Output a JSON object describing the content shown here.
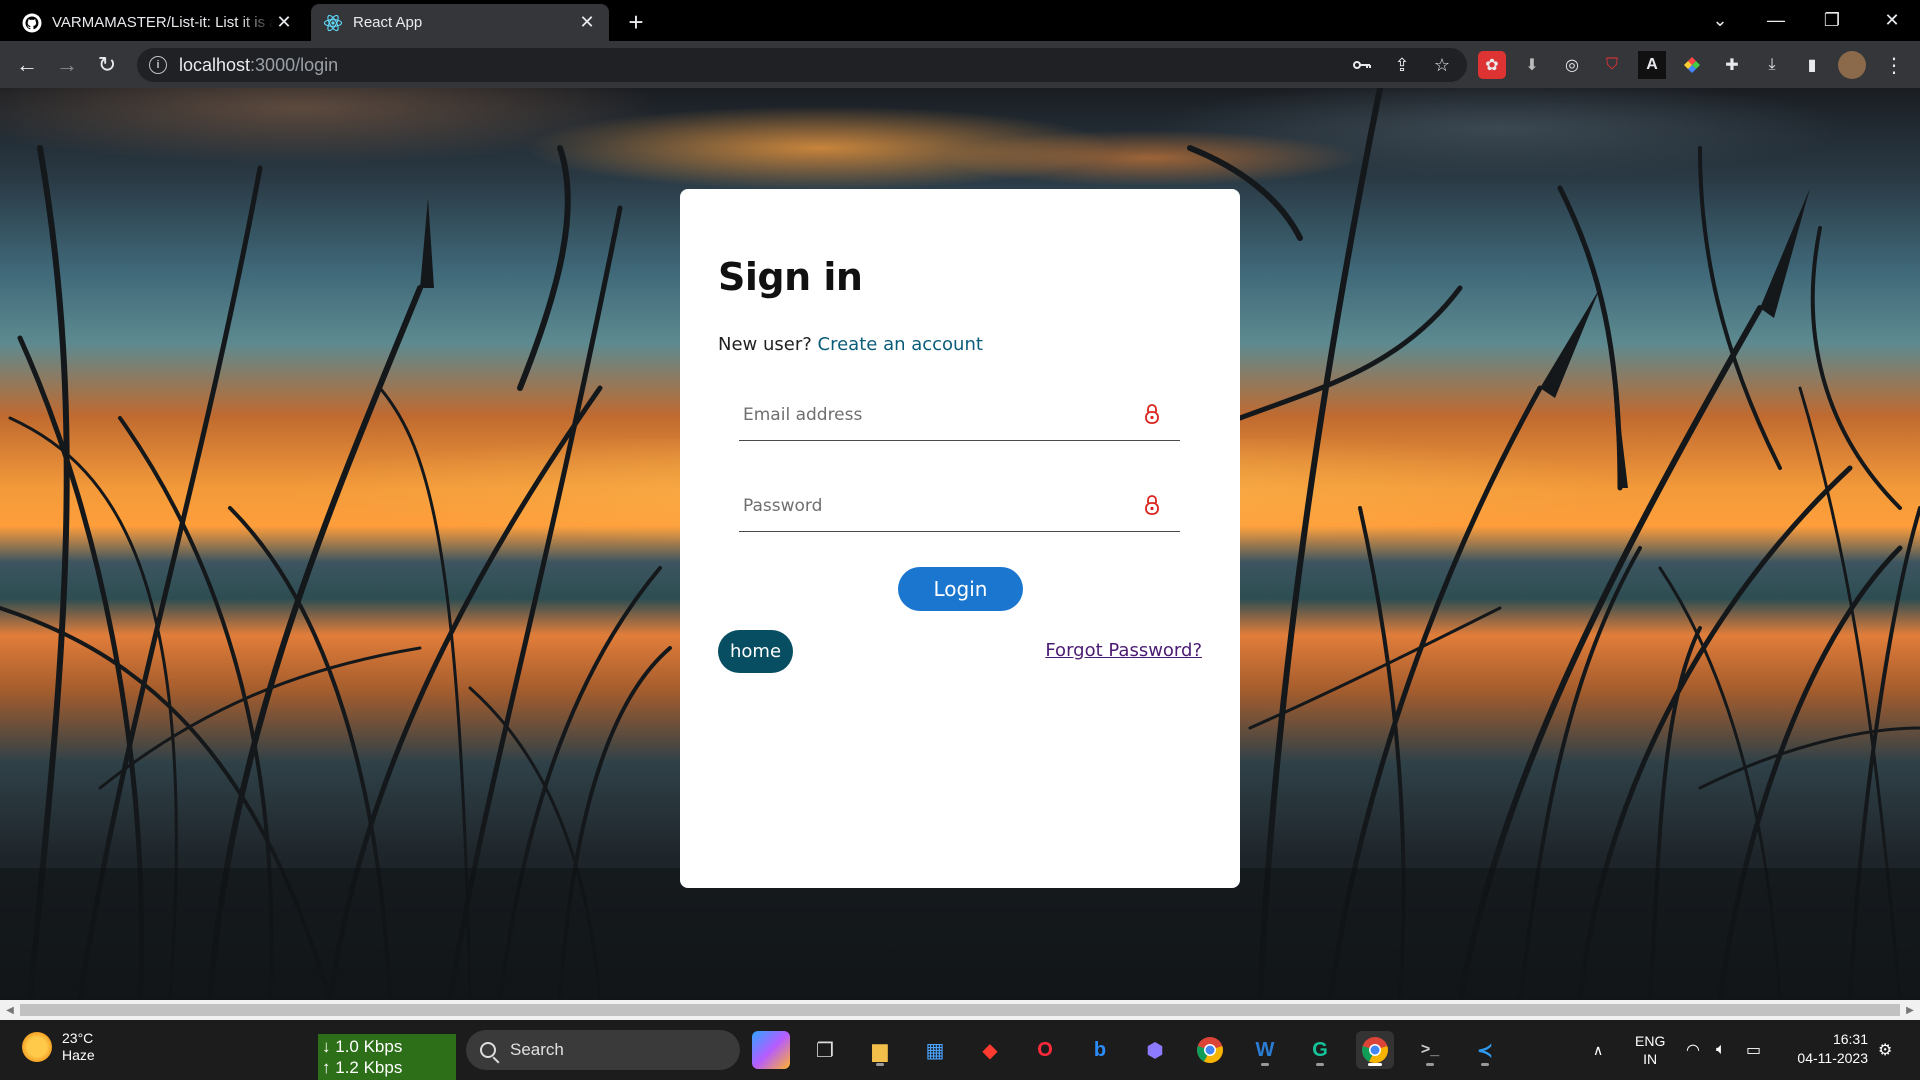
{
  "browser": {
    "tabs": [
      {
        "title": "VARMAMASTER/List-it: List it is a",
        "active": false,
        "icon": "github-icon"
      },
      {
        "title": "React App",
        "active": true,
        "icon": "react-icon"
      }
    ],
    "url_host": "localhost",
    "url_path": ":3000/login"
  },
  "login": {
    "title": "Sign in",
    "new_user_text": "New user?",
    "create_account_link": "Create an account",
    "email_placeholder": "Email address",
    "password_placeholder": "Password",
    "login_button": "Login",
    "home_button": "home",
    "forgot_link": "Forgot Password?"
  },
  "taskbar": {
    "weather_temp": "23°C",
    "weather_desc": "Haze",
    "net_down": "1.0 Kbps",
    "net_up": "1.2 Kbps",
    "search_label": "Search",
    "lang_top": "ENG",
    "lang_bottom": "IN",
    "time": "16:31",
    "date": "04-11-2023"
  },
  "colors": {
    "login_button": "#1a76cf",
    "home_button": "#084e63",
    "forgot_link": "#4b1c73",
    "create_link": "#0b5c7a",
    "lock_icon": "#d9251d"
  }
}
